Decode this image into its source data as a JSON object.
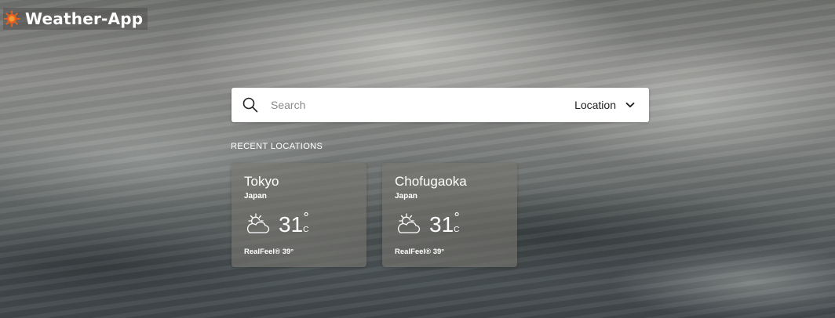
{
  "app": {
    "title": "Weather-App",
    "logo_icon": "sun-icon",
    "logo_color": "#e8601c"
  },
  "search": {
    "placeholder": "Search",
    "icon": "search-icon",
    "location_label": "Location",
    "location_icon": "chevron-down-icon"
  },
  "recent": {
    "title": "RECENT LOCATIONS",
    "cards": [
      {
        "city": "Tokyo",
        "country": "Japan",
        "icon": "partly-cloudy-icon",
        "temp": "31",
        "deg": "°",
        "unit": "C",
        "realfeel": "RealFeel® 39°"
      },
      {
        "city": "Chofugaoka",
        "country": "Japan",
        "icon": "partly-cloudy-icon",
        "temp": "31",
        "deg": "°",
        "unit": "C",
        "realfeel": "RealFeel® 39°"
      }
    ]
  }
}
